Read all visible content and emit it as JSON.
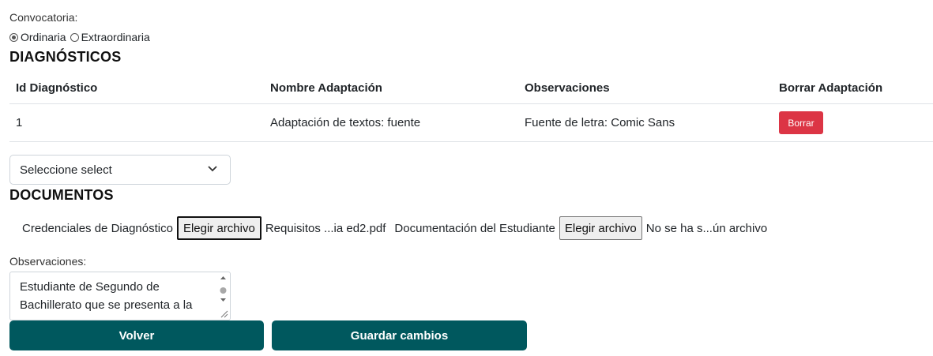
{
  "convocatoria": {
    "label": "Convocatoria:",
    "options": [
      {
        "label": "Ordinaria",
        "checked": true
      },
      {
        "label": "Extraordinaria",
        "checked": false
      }
    ]
  },
  "diagnosticos": {
    "title": "DIAGNÓSTICOS",
    "columns": [
      "Id Diagnóstico",
      "Nombre Adaptación",
      "Observaciones",
      "Borrar Adaptación"
    ],
    "rows": [
      {
        "id": "1",
        "nombre": "Adaptación de textos: fuente",
        "observaciones": "Fuente de letra: Comic Sans",
        "action": "Borrar"
      }
    ],
    "select_value": "Seleccione select"
  },
  "documentos": {
    "title": "DOCUMENTOS",
    "files": [
      {
        "label": "Credenciales de Diagnóstico",
        "button": "Elegir archivo",
        "filename": "Requisitos ...ia ed2.pdf"
      },
      {
        "label": "Documentación del Estudiante",
        "button": "Elegir archivo",
        "filename": "No se ha s...ún archivo"
      }
    ]
  },
  "observaciones": {
    "label": "Observaciones:",
    "value": "Estudiante de Segundo de Bachillerato que se presenta a la"
  },
  "buttons": {
    "volver": "Volver",
    "guardar": "Guardar cambios"
  },
  "colors": {
    "primary": "#00585e",
    "danger": "#dc3545"
  }
}
